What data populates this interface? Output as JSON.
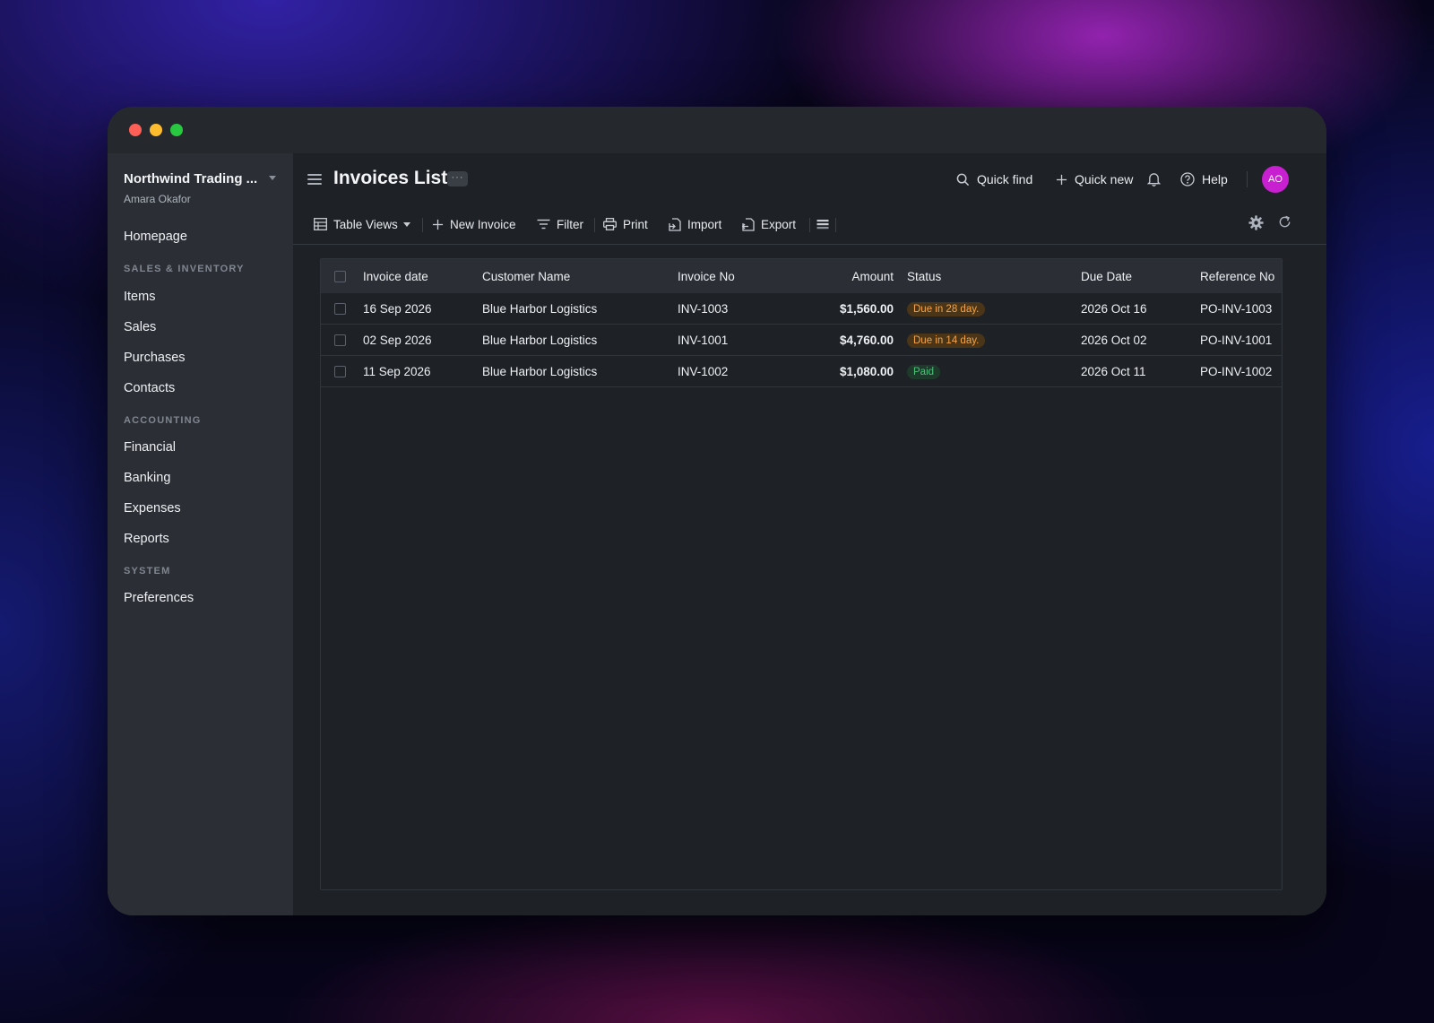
{
  "window": {
    "controls": [
      "close",
      "minimize",
      "zoom"
    ]
  },
  "sidebar": {
    "org_name": "Northwind Trading ...",
    "user_name": "Amara Okafor",
    "home": "Homepage",
    "sections": [
      {
        "title": "SALES & INVENTORY",
        "items": [
          "Items",
          "Sales",
          "Purchases",
          "Contacts"
        ]
      },
      {
        "title": "ACCOUNTING",
        "items": [
          "Financial",
          "Banking",
          "Expenses",
          "Reports"
        ]
      },
      {
        "title": "SYSTEM",
        "items": [
          "Preferences"
        ]
      }
    ]
  },
  "header": {
    "title": "Invoices List",
    "more": "···",
    "quick_find": "Quick find",
    "quick_new": "Quick new",
    "help": "Help",
    "avatar_initials": "AO",
    "avatar_color": "#c81fd0"
  },
  "toolbar": {
    "table_views": "Table Views",
    "new_invoice": "New Invoice",
    "filter": "Filter",
    "print": "Print",
    "import": "Import",
    "export": "Export"
  },
  "table": {
    "columns": [
      "Invoice date",
      "Customer Name",
      "Invoice No",
      "Amount",
      "Status",
      "Due Date",
      "Reference No"
    ],
    "rows": [
      {
        "date": "16 Sep 2026",
        "customer": "Blue Harbor Logistics",
        "invoice_no": "INV-1003",
        "amount": "$1,560.00",
        "status": "Due in 28 day.",
        "status_type": "due",
        "due_date": "2026 Oct 16",
        "reference": "PO-INV-1003"
      },
      {
        "date": "02 Sep 2026",
        "customer": "Blue Harbor Logistics",
        "invoice_no": "INV-1001",
        "amount": "$4,760.00",
        "status": "Due in 14 day.",
        "status_type": "due",
        "due_date": "2026 Oct 02",
        "reference": "PO-INV-1001"
      },
      {
        "date": "11 Sep 2026",
        "customer": "Blue Harbor Logistics",
        "invoice_no": "INV-1002",
        "amount": "$1,080.00",
        "status": "Paid",
        "status_type": "paid",
        "due_date": "2026 Oct 11",
        "reference": "PO-INV-1002"
      }
    ]
  },
  "colors": {
    "due_text": "#f2a54a",
    "paid_text": "#49c27a",
    "sidebar_bg": "#2b2f35",
    "main_bg": "#1e2227"
  }
}
